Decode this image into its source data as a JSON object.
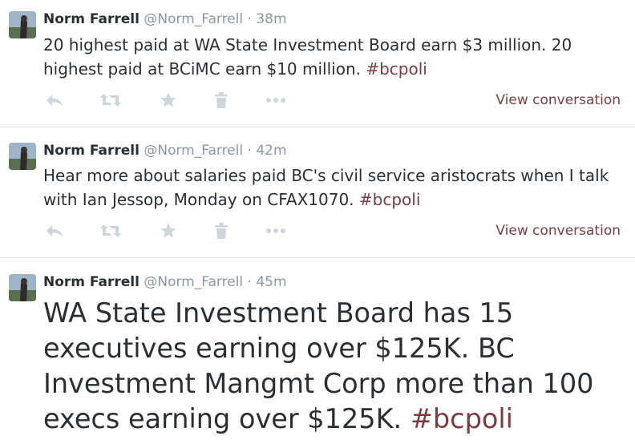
{
  "tweets": [
    {
      "fullname": "Norm Farrell",
      "username": "@Norm_Farrell",
      "separator": "·",
      "time": "38m",
      "text": "20 highest paid at WA State Investment Board earn $3 million. 20 highest paid at BCiMC earn $10 million. ",
      "hashtag": "#bcpoli",
      "view_conversation": "View conversation"
    },
    {
      "fullname": "Norm Farrell",
      "username": "@Norm_Farrell",
      "separator": "·",
      "time": "42m",
      "text": "Hear more about salaries paid BC's civil service aristocrats when I talk with Ian Jessop, Monday on CFAX1070. ",
      "hashtag": "#bcpoli",
      "view_conversation": "View conversation"
    },
    {
      "fullname": "Norm Farrell",
      "username": "@Norm_Farrell",
      "separator": "·",
      "time": "45m",
      "text": "WA State Investment Board has 15 executives earning over $125K. BC Investment Mangmt Corp more than 100 execs earning over $125K. ",
      "hashtag": "#bcpoli"
    }
  ],
  "icons": {
    "reply": "reply-icon",
    "retweet": "retweet-icon",
    "favorite": "star-icon",
    "delete": "trash-icon",
    "more": "more-icon"
  },
  "colors": {
    "text": "#292f33",
    "muted": "#8899a6",
    "action_icon": "#ccd6dd",
    "link": "#7d3c3f",
    "divider": "#e1e8ed"
  }
}
